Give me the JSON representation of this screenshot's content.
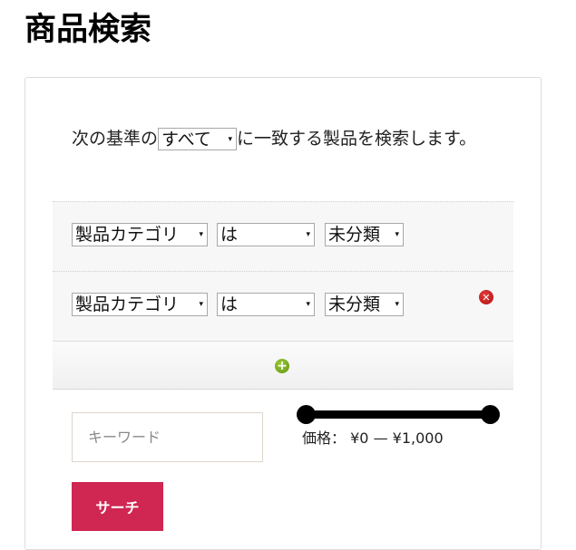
{
  "page": {
    "title": "商品検索"
  },
  "intro": {
    "prefix": "次の基準の",
    "match_mode": "すべて",
    "suffix": "に一致する製品を検索します。"
  },
  "rules": [
    {
      "field": "製品カテゴリ",
      "operator": "は",
      "value": "未分類",
      "removable": false
    },
    {
      "field": "製品カテゴリ",
      "operator": "は",
      "value": "未分類",
      "removable": true
    }
  ],
  "icons": {
    "dropdown": "▾",
    "remove": "✕",
    "add": "+"
  },
  "keyword": {
    "placeholder": "キーワード",
    "value": ""
  },
  "price": {
    "label": "価格：",
    "min_display": "¥0",
    "separator": "—",
    "max_display": "¥1,000",
    "range_min": 0,
    "range_max": 1000,
    "selected_min": 0,
    "selected_max": 1000
  },
  "search_button": {
    "label": "サーチ"
  },
  "colors": {
    "search_button": "#cf2652",
    "remove_icon": "#c41a1a",
    "add_icon": "#7cb01f",
    "slider": "#000000"
  }
}
